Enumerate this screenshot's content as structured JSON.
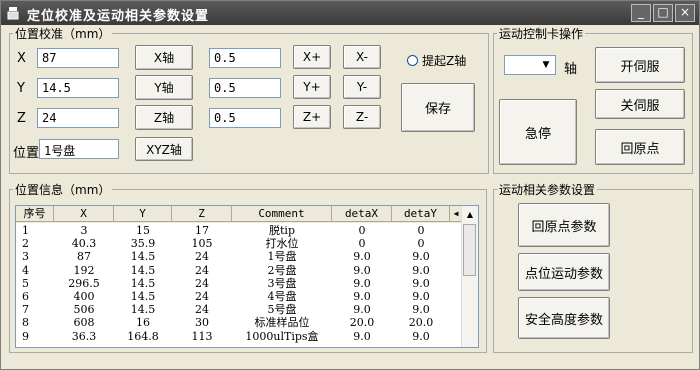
{
  "window": {
    "title": "定位校准及运动相关参数设置",
    "minimize": "_",
    "maximize": "□",
    "close": "×"
  },
  "calib": {
    "group_label": "位置校准（mm）",
    "rows": [
      {
        "axis": "X",
        "value": "87",
        "axis_button": "X轴",
        "step": "0.5",
        "plus": "X+",
        "minus": "X-"
      },
      {
        "axis": "Y",
        "value": "14.5",
        "axis_button": "Y轴",
        "step": "0.5",
        "plus": "Y+",
        "minus": "Y-"
      },
      {
        "axis": "Z",
        "value": "24",
        "axis_button": "Z轴",
        "step": "0.5",
        "plus": "Z+",
        "minus": "Z-"
      }
    ],
    "position_label": "位置",
    "position_value": "1号盘",
    "xyz_button": "XYZ轴",
    "lift_z": "提起Z轴",
    "save_button": "保存"
  },
  "motion": {
    "group_label": "运动控制卡操作",
    "axis_select_value": "",
    "axis_label": "轴",
    "servo_on": "开伺服",
    "servo_off": "关伺服",
    "estop": "急停",
    "home": "回原点"
  },
  "info": {
    "group_label": "位置信息（mm）",
    "columns": [
      "序号",
      "X",
      "Y",
      "Z",
      "Comment",
      "detaX",
      "detaY"
    ],
    "rows": [
      [
        "1",
        "3",
        "15",
        "17",
        "脱tip",
        "0",
        "0"
      ],
      [
        "2",
        "40.3",
        "35.9",
        "105",
        "打水位",
        "0",
        "0"
      ],
      [
        "3",
        "87",
        "14.5",
        "24",
        "1号盘",
        "9.0",
        "9.0"
      ],
      [
        "4",
        "192",
        "14.5",
        "24",
        "2号盘",
        "9.0",
        "9.0"
      ],
      [
        "5",
        "296.5",
        "14.5",
        "24",
        "3号盘",
        "9.0",
        "9.0"
      ],
      [
        "6",
        "400",
        "14.5",
        "24",
        "4号盘",
        "9.0",
        "9.0"
      ],
      [
        "7",
        "506",
        "14.5",
        "24",
        "5号盘",
        "9.0",
        "9.0"
      ],
      [
        "8",
        "608",
        "16",
        "30",
        "标准样品位",
        "20.0",
        "20.0"
      ],
      [
        "9",
        "36.3",
        "164.8",
        "113",
        "1000ulTips盒",
        "9.0",
        "9.0"
      ]
    ]
  },
  "params": {
    "group_label": "运动相关参数设置",
    "home_params": "回原点参数",
    "point_motion_params": "点位运动参数",
    "safe_height_params": "安全高度参数"
  }
}
